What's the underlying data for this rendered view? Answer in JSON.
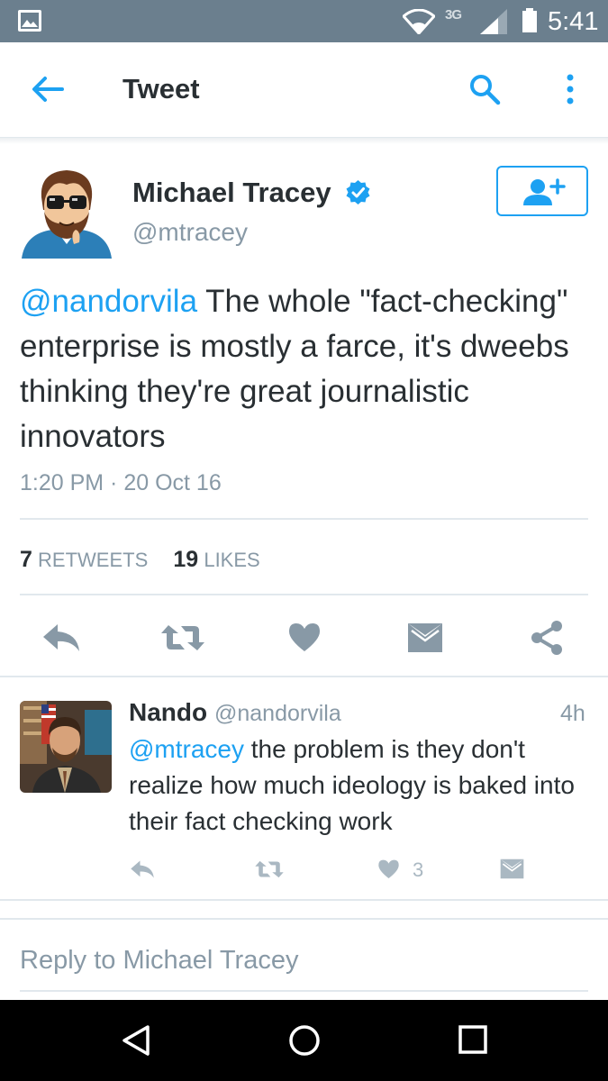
{
  "status_bar": {
    "network": "3G",
    "time": "5:41"
  },
  "app_bar": {
    "title": "Tweet"
  },
  "tweet": {
    "author": {
      "name": "Michael Tracey",
      "handle": "@mtracey",
      "verified": true
    },
    "mention": "@nandorvila",
    "text": " The whole \"fact-checking\" enterprise is mostly a farce, it's dweebs thinking they're great journalistic innovators",
    "timestamp": "1:20 PM · 20 Oct 16",
    "stats": {
      "retweets_count": "7",
      "retweets_label": "RETWEETS",
      "likes_count": "19",
      "likes_label": "LIKES"
    }
  },
  "reply": {
    "author_name": "Nando",
    "author_handle": "@nandorvila",
    "time": "4h",
    "mention": "@mtracey",
    "text": " the problem is they don't realize how much ideology is baked into their fact checking work",
    "like_count": "3"
  },
  "composer": {
    "placeholder": "Reply to Michael Tracey"
  },
  "colors": {
    "status_bar": "#6b7f8e",
    "accent": "#1da1f2",
    "secondary_text": "#8899a6",
    "action_icon": "#8899a6",
    "divider": "#e1e8ed"
  },
  "icons": {
    "status": [
      "gallery-icon",
      "wifi-icon",
      "signal-icon",
      "battery-icon"
    ],
    "app_bar": [
      "back-arrow-icon",
      "search-icon",
      "more-vert-icon"
    ],
    "actions": [
      "reply-icon",
      "retweet-icon",
      "like-icon",
      "direct-message-icon",
      "share-icon"
    ],
    "nav": [
      "nav-back-icon",
      "nav-home-icon",
      "nav-recents-icon"
    ]
  }
}
